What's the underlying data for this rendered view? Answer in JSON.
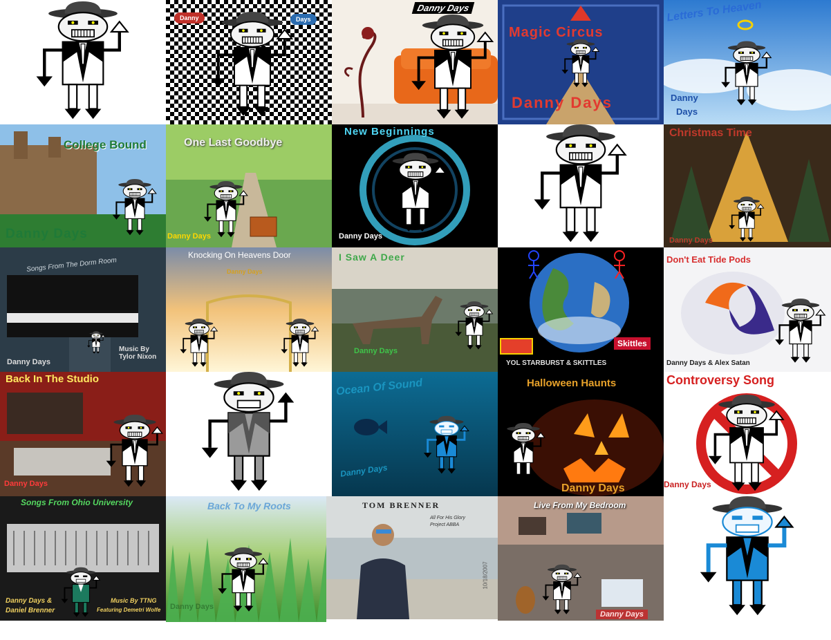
{
  "tiles": {
    "t02": {
      "danny": "Danny",
      "days": "Days"
    },
    "t03": {
      "artist": "Danny Days"
    },
    "t04": {
      "title": "Magic Circus",
      "artist": "Danny Days"
    },
    "t05": {
      "title": "Letters To Heaven",
      "artist_1": "Danny",
      "artist_2": "Days"
    },
    "t06": {
      "title": "College Bound",
      "artist": "Danny Days"
    },
    "t07": {
      "title": "One Last Goodbye",
      "artist": "Danny Days"
    },
    "t08": {
      "title": "New Beginnings",
      "artist": "Danny Days"
    },
    "t10": {
      "title": "Christmas Time",
      "artist": "Danny Days"
    },
    "t11": {
      "title": "Songs From The Dorm Room",
      "artist": "Danny Days",
      "credit": "Music By\nTylor Nixon"
    },
    "t12": {
      "title": "Knocking On Heavens Door",
      "artist": "Danny Days"
    },
    "t13": {
      "title": "I Saw A Deer",
      "artist": "Danny Days"
    },
    "t14": {
      "title": "YOL STARBURST & SKITTLES",
      "brand_1": "Skittles"
    },
    "t15": {
      "title": "Don't Eat Tide Pods",
      "artist": "Danny Days & Alex Satan"
    },
    "t16": {
      "title": "Back In The Studio",
      "artist": "Danny Days"
    },
    "t18": {
      "title": "Ocean Of Sound",
      "artist": "Danny Days"
    },
    "t19": {
      "title": "Halloween Haunts",
      "artist": "Danny Days"
    },
    "t20": {
      "title": "Controversy Song",
      "artist": "Danny Days"
    },
    "t21": {
      "title": "Songs From Ohio University",
      "artist_1": "Danny Days &",
      "artist_2": "Daniel Brenner",
      "credit_1": "Music By TTNG",
      "credit_2": "Featuring Demetri Wolfe"
    },
    "t22": {
      "title": "Back To My Roots",
      "artist": "Danny Days"
    },
    "t23": {
      "title": "TOM BRENNER",
      "subtitle_1": "All For His Glory",
      "subtitle_2": "Project ABBA",
      "date": "10/18/2007"
    },
    "t24": {
      "title": "Live From My Bedroom",
      "artist": "Danny Days"
    }
  }
}
